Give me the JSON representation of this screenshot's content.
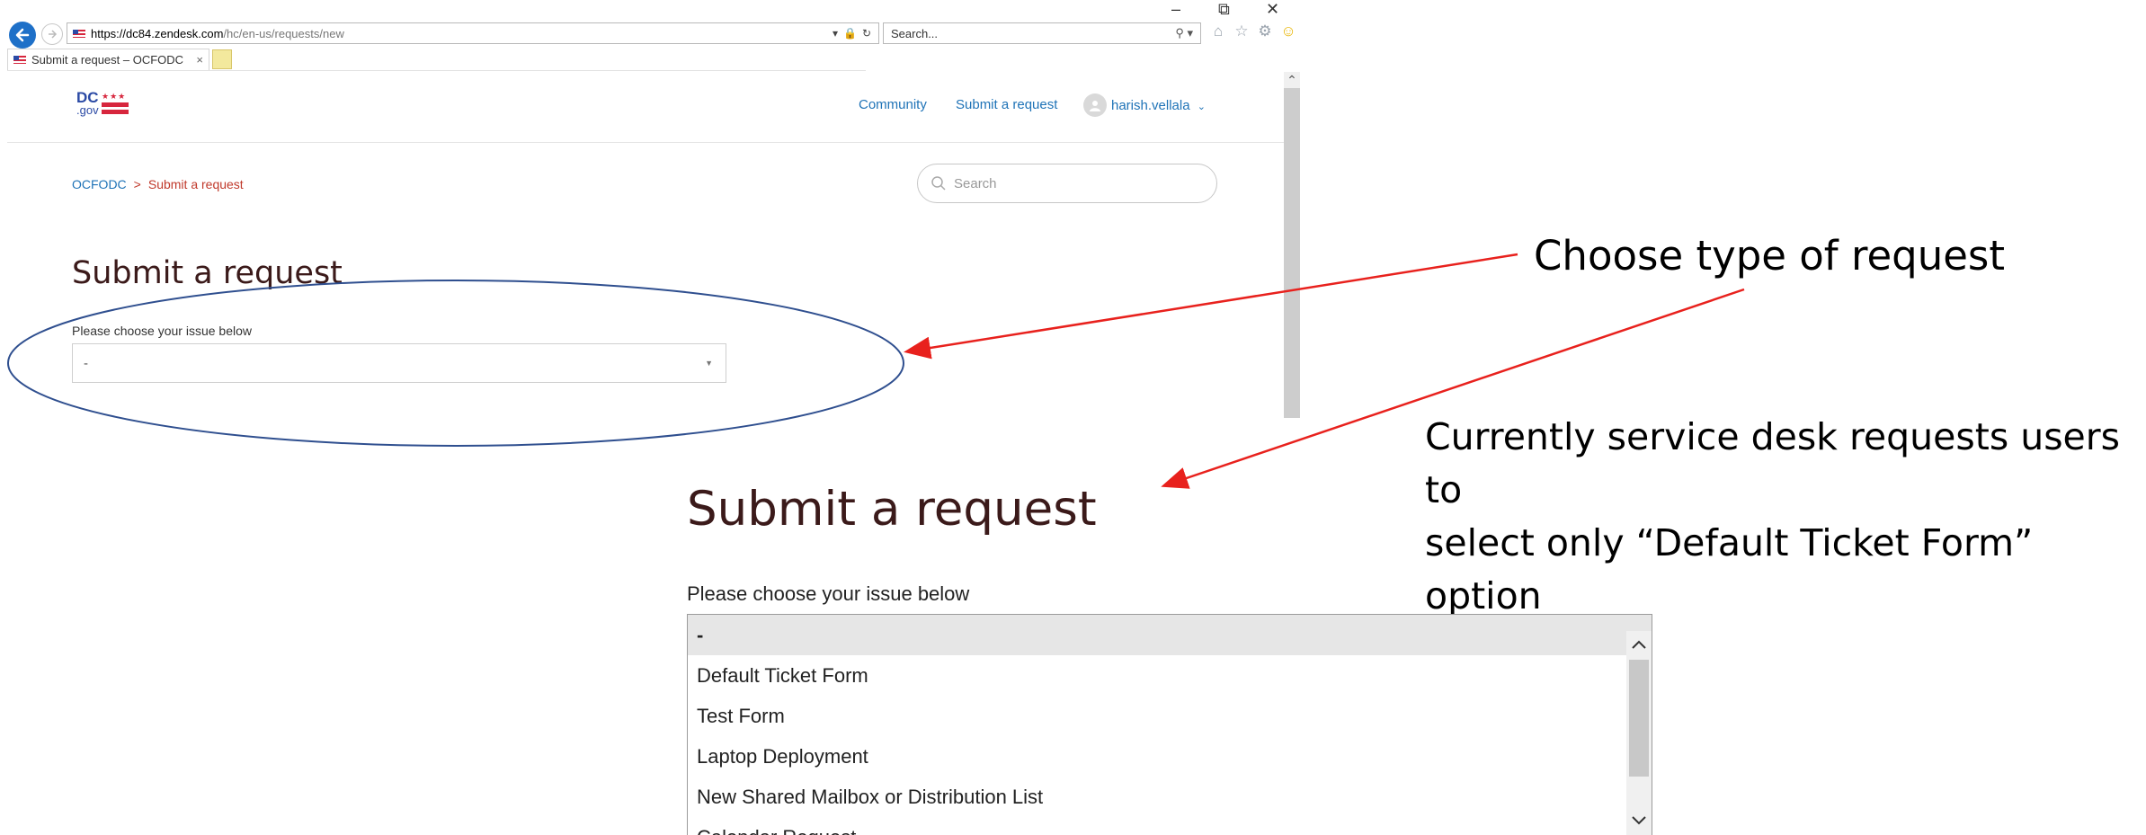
{
  "browser": {
    "address": {
      "protocol": "https://",
      "host": "dc84.zendesk.com",
      "path": "/hc/en-us/requests/new"
    },
    "search_placeholder": "Search...",
    "tab_title": "Submit a request – OCFODC",
    "tab_close": "×",
    "window_controls": [
      "–",
      "⧉",
      "✕"
    ],
    "icons": [
      "back-icon",
      "forward-icon",
      "home-icon",
      "favorites-star-icon",
      "settings-gear-icon",
      "feedback-smiley-icon"
    ]
  },
  "site": {
    "logo": {
      "dc": "DC",
      "gov": ".gov"
    },
    "nav": {
      "community": "Community",
      "submit": "Submit a request",
      "user": "harish.vellala"
    },
    "breadcrumb": {
      "home": "OCFODC",
      "separator": ">",
      "current": "Submit a request"
    },
    "search_placeholder": "Search",
    "title": "Submit a request",
    "issue_label": "Please choose your issue below",
    "issue_value": "-"
  },
  "annotations": {
    "choose_type": "Choose type of request",
    "note_line1": "Currently service desk requests users to",
    "note_line2": "select only “Default Ticket Form” option",
    "arrow_color": "#e8211d",
    "ellipse_color": "#2f4f8f"
  },
  "zoom": {
    "title": "Submit a request",
    "label": "Please choose your issue below",
    "options": [
      "-",
      "Default Ticket Form",
      "Test Form",
      "Laptop Deployment",
      "New Shared Mailbox or Distribution List",
      "Calendar Request"
    ],
    "selected_index": 0
  },
  "colors": {
    "link": "#1f73b7",
    "breadcrumb_current": "#c0392b",
    "title": "#3b1a1a"
  }
}
